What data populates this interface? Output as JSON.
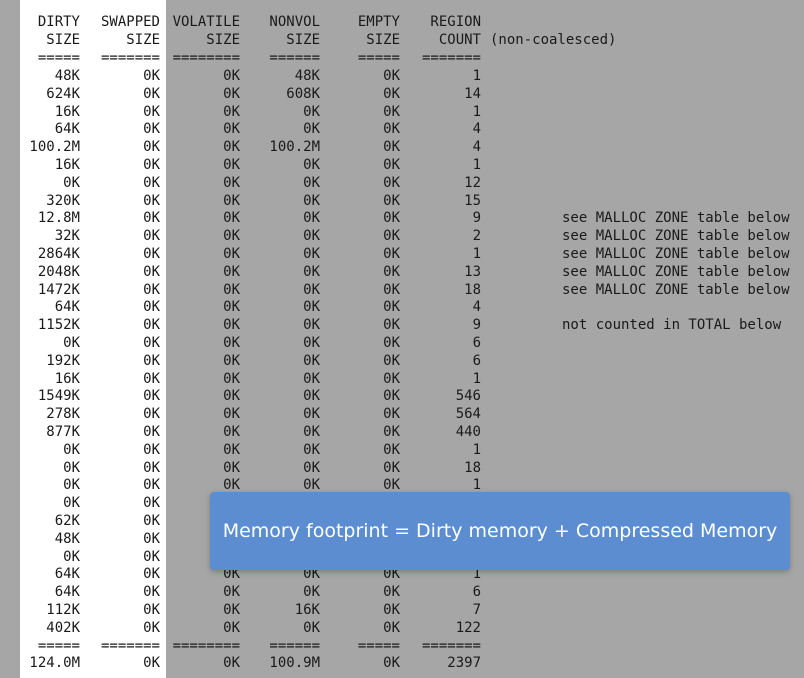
{
  "headers": [
    [
      "DIRTY",
      "SIZE",
      "====="
    ],
    [
      "SWAPPED",
      "SIZE",
      "======="
    ],
    [
      "VOLATILE",
      "SIZE",
      "========"
    ],
    [
      "NONVOL",
      "SIZE",
      "======"
    ],
    [
      "EMPTY",
      "SIZE",
      "====="
    ],
    [
      "REGION",
      "COUNT",
      "======="
    ]
  ],
  "header_note": "(non-coalesced)",
  "rows": [
    [
      "48K",
      "0K",
      "0K",
      "48K",
      "0K",
      "1"
    ],
    [
      "624K",
      "0K",
      "0K",
      "608K",
      "0K",
      "14"
    ],
    [
      "16K",
      "0K",
      "0K",
      "0K",
      "0K",
      "1"
    ],
    [
      "64K",
      "0K",
      "0K",
      "0K",
      "0K",
      "4"
    ],
    [
      "100.2M",
      "0K",
      "0K",
      "100.2M",
      "0K",
      "4"
    ],
    [
      "16K",
      "0K",
      "0K",
      "0K",
      "0K",
      "1"
    ],
    [
      "0K",
      "0K",
      "0K",
      "0K",
      "0K",
      "12"
    ],
    [
      "320K",
      "0K",
      "0K",
      "0K",
      "0K",
      "15"
    ],
    [
      "12.8M",
      "0K",
      "0K",
      "0K",
      "0K",
      "9"
    ],
    [
      "32K",
      "0K",
      "0K",
      "0K",
      "0K",
      "2"
    ],
    [
      "2864K",
      "0K",
      "0K",
      "0K",
      "0K",
      "1"
    ],
    [
      "2048K",
      "0K",
      "0K",
      "0K",
      "0K",
      "13"
    ],
    [
      "1472K",
      "0K",
      "0K",
      "0K",
      "0K",
      "18"
    ],
    [
      "64K",
      "0K",
      "0K",
      "0K",
      "0K",
      "4"
    ],
    [
      "1152K",
      "0K",
      "0K",
      "0K",
      "0K",
      "9"
    ],
    [
      "0K",
      "0K",
      "0K",
      "0K",
      "0K",
      "6"
    ],
    [
      "192K",
      "0K",
      "0K",
      "0K",
      "0K",
      "6"
    ],
    [
      "16K",
      "0K",
      "0K",
      "0K",
      "0K",
      "1"
    ],
    [
      "1549K",
      "0K",
      "0K",
      "0K",
      "0K",
      "546"
    ],
    [
      "278K",
      "0K",
      "0K",
      "0K",
      "0K",
      "564"
    ],
    [
      "877K",
      "0K",
      "0K",
      "0K",
      "0K",
      "440"
    ],
    [
      "0K",
      "0K",
      "0K",
      "0K",
      "0K",
      "1"
    ],
    [
      "0K",
      "0K",
      "0K",
      "0K",
      "0K",
      "18"
    ],
    [
      "0K",
      "0K",
      "0K",
      "0K",
      "0K",
      "1"
    ],
    [
      "0K",
      "0K",
      "",
      "",
      "",
      ""
    ],
    [
      "62K",
      "0K",
      "",
      "",
      "",
      ""
    ],
    [
      "48K",
      "0K",
      "",
      "",
      "",
      ""
    ],
    [
      "0K",
      "0K",
      "",
      "",
      "",
      ""
    ],
    [
      "64K",
      "0K",
      "0K",
      "0K",
      "0K",
      "1"
    ],
    [
      "64K",
      "0K",
      "0K",
      "0K",
      "0K",
      "6"
    ],
    [
      "112K",
      "0K",
      "0K",
      "16K",
      "0K",
      "7"
    ],
    [
      "402K",
      "0K",
      "0K",
      "0K",
      "0K",
      "122"
    ]
  ],
  "footer_separators": [
    "=====",
    "=======",
    "========",
    "======",
    "=====",
    "======="
  ],
  "totals": [
    "124.0M",
    "0K",
    "0K",
    "100.9M",
    "0K",
    "2397"
  ],
  "row_notes": [
    {
      "row": 8,
      "text": "see MALLOC ZONE table below"
    },
    {
      "row": 9,
      "text": "see MALLOC ZONE table below"
    },
    {
      "row": 10,
      "text": "see MALLOC ZONE table below"
    },
    {
      "row": 11,
      "text": "see MALLOC ZONE table below"
    },
    {
      "row": 12,
      "text": "see MALLOC ZONE table below"
    },
    {
      "row": 14,
      "text": "not counted in TOTAL below"
    }
  ],
  "callout": "Memory footprint = Dirty memory + Compressed Memory"
}
